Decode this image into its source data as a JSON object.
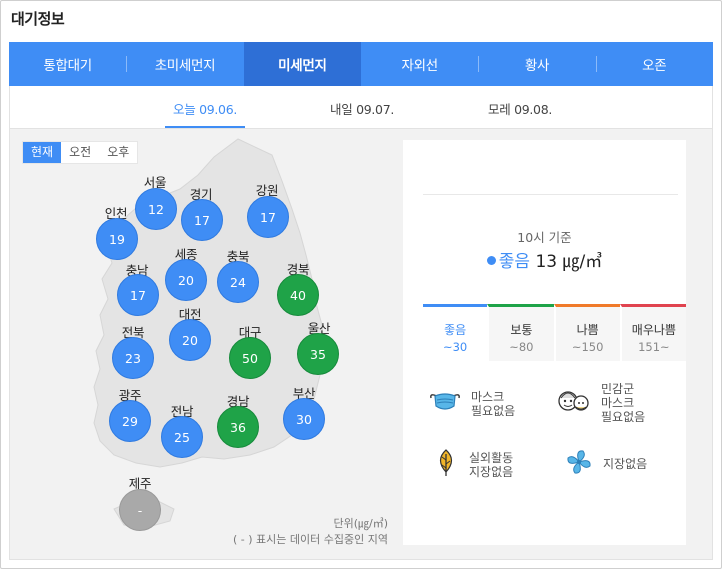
{
  "widget": {
    "title": "대기정보"
  },
  "tabs": [
    {
      "label": "통합대기"
    },
    {
      "label": "초미세먼지"
    },
    {
      "label": "미세먼지"
    },
    {
      "label": "자외선"
    },
    {
      "label": "황사"
    },
    {
      "label": "오존"
    }
  ],
  "dates": [
    {
      "label": "오늘 09.06."
    },
    {
      "label": "내일 09.07."
    },
    {
      "label": "모레 09.08."
    }
  ],
  "time_toggle": [
    {
      "label": "현재"
    },
    {
      "label": "오전"
    },
    {
      "label": "오후"
    }
  ],
  "regions": [
    {
      "name": "서울",
      "value": "12",
      "grade": "good"
    },
    {
      "name": "경기",
      "value": "17",
      "grade": "good"
    },
    {
      "name": "강원",
      "value": "17",
      "grade": "good"
    },
    {
      "name": "인천",
      "value": "19",
      "grade": "good"
    },
    {
      "name": "세종",
      "value": "20",
      "grade": "good"
    },
    {
      "name": "충북",
      "value": "24",
      "grade": "good"
    },
    {
      "name": "충남",
      "value": "17",
      "grade": "good"
    },
    {
      "name": "경북",
      "value": "40",
      "grade": "normal"
    },
    {
      "name": "대전",
      "value": "20",
      "grade": "good"
    },
    {
      "name": "대구",
      "value": "50",
      "grade": "normal"
    },
    {
      "name": "울산",
      "value": "35",
      "grade": "normal"
    },
    {
      "name": "전북",
      "value": "23",
      "grade": "good"
    },
    {
      "name": "광주",
      "value": "29",
      "grade": "good"
    },
    {
      "name": "전남",
      "value": "25",
      "grade": "good"
    },
    {
      "name": "경남",
      "value": "36",
      "grade": "normal"
    },
    {
      "name": "부산",
      "value": "30",
      "grade": "good"
    },
    {
      "name": "제주",
      "value": "-",
      "grade": "none"
    }
  ],
  "notes": {
    "unit": "단위(㎍/㎥)",
    "missing": "( - ) 표시는 데이터 수집중인 지역"
  },
  "panel": {
    "base_time": "10시 기준",
    "grade": "좋음",
    "value": "13 ㎍/㎥"
  },
  "grades": [
    {
      "name": "좋음",
      "range": "~30",
      "color": "#3f8df5"
    },
    {
      "name": "보통",
      "range": "~80",
      "color": "#1fa348"
    },
    {
      "name": "나쁨",
      "range": "~150",
      "color": "#f07a2a"
    },
    {
      "name": "매우나쁨",
      "range": "151~",
      "color": "#e0434f"
    }
  ],
  "advice": [
    {
      "lines": [
        "마스크",
        "필요없음"
      ],
      "icon": "mask-icon"
    },
    {
      "lines": [
        "민감군",
        "마스크",
        "필요없음"
      ],
      "icon": "sensitive-group-icon"
    },
    {
      "lines": [
        "실외활동",
        "지장없음"
      ],
      "icon": "leaf-icon"
    },
    {
      "lines": [
        "지장없음"
      ],
      "icon": "fan-icon"
    }
  ],
  "colors": {
    "accent": "#3f8df5",
    "accent_dark": "#2e6fd6",
    "good": "#3f8df5",
    "normal": "#1fa348",
    "no_data": "#a9a9a9",
    "map_land": "#e4e4e4"
  }
}
